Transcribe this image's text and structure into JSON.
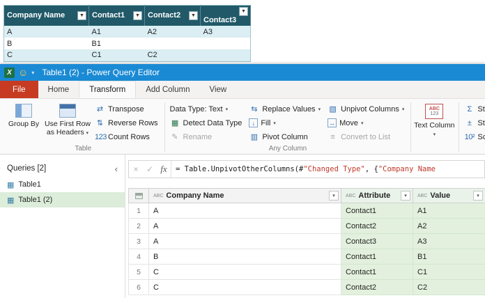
{
  "colors": {
    "titlebar_blue": "#1a8ad4",
    "file_tab_red": "#c63b22",
    "excel_header_teal": "#215968",
    "excel_band_blue": "#daeef3",
    "selected_query_green": "#dcedda",
    "new_column_green": "#e2f0dd"
  },
  "icons": {
    "caret": "▾",
    "filter": "▼",
    "excel_x": "X",
    "smiley": "☺",
    "transpose": "⇄",
    "reverse_rows": "⇅",
    "count_rows": "123",
    "detect": "▦",
    "rename": "✎",
    "replace": "⇆",
    "fill": "↓",
    "pivot": "▥",
    "unpivot": "▧",
    "move": "↔",
    "convert_list": "≡",
    "sigma": "Σ",
    "plus_minus": "±",
    "scientific": "10²",
    "cancel": "×",
    "check": "✓",
    "fx": "fx",
    "collapse": "‹",
    "query": "▦",
    "abc": "ABC",
    "abc123_top": "ABC",
    "abc123_bottom": "123"
  },
  "sheet": {
    "headers": [
      "Company Name",
      "Contact1",
      "Contact2",
      "Contact3"
    ],
    "rows": [
      [
        "A",
        "A1",
        "A2",
        "A3"
      ],
      [
        "B",
        "B1",
        "",
        ""
      ],
      [
        "C",
        "C1",
        "C2",
        ""
      ]
    ]
  },
  "titlebar": {
    "title": "Table1 (2) - Power Query Editor"
  },
  "tabs": {
    "file": "File",
    "home": "Home",
    "transform": "Transform",
    "add_column": "Add Column",
    "view": "View"
  },
  "ribbon": {
    "group_by": "Group By",
    "use_first_row": "Use First Row as Headers",
    "transpose": "Transpose",
    "reverse_rows": "Reverse Rows",
    "count_rows": "Count Rows",
    "table_label": "Table",
    "data_type": "Data Type: Text",
    "detect_data_type": "Detect Data Type",
    "rename": "Rename",
    "replace_values": "Replace Values",
    "fill": "Fill",
    "pivot_column": "Pivot Column",
    "unpivot_columns": "Unpivot Columns",
    "move": "Move",
    "convert_to_list": "Convert to List",
    "any_column_label": "Any Column",
    "text_column": "Text Column",
    "statistics": "Statis",
    "standard": "Stand",
    "scientific": "Scien"
  },
  "queries": {
    "header": "Queries [2]",
    "items": [
      {
        "label": "Table1"
      },
      {
        "label": "Table1 (2)"
      }
    ]
  },
  "formula": {
    "prefix": "= Table.UnpivotOtherColumns(#",
    "string1": "\"Changed Type\"",
    "middle": ", {",
    "string2": "\"Company Name"
  },
  "grid": {
    "columns": [
      "Company Name",
      "Attribute",
      "Value"
    ],
    "rows": [
      [
        "1",
        "A",
        "Contact1",
        "A1"
      ],
      [
        "2",
        "A",
        "Contact2",
        "A2"
      ],
      [
        "3",
        "A",
        "Contact3",
        "A3"
      ],
      [
        "4",
        "B",
        "Contact1",
        "B1"
      ],
      [
        "5",
        "C",
        "Contact1",
        "C1"
      ],
      [
        "6",
        "C",
        "Contact2",
        "C2"
      ]
    ]
  }
}
